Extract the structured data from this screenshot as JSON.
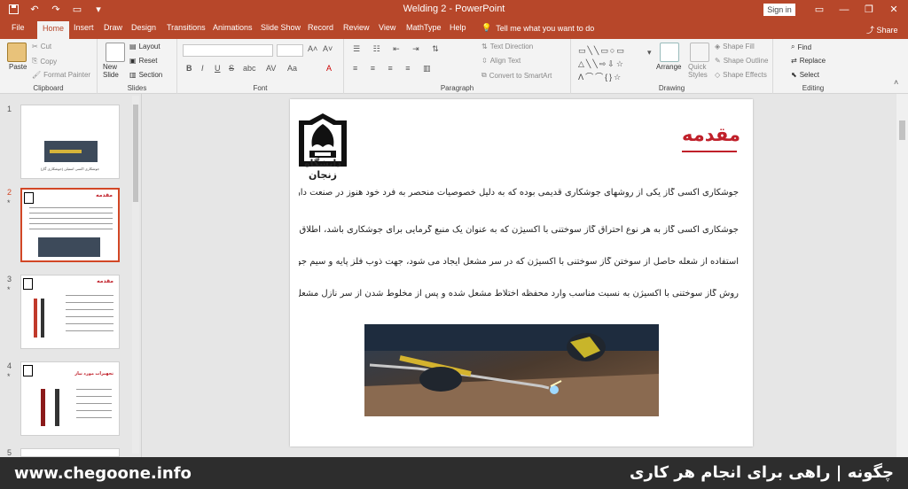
{
  "window": {
    "title": "Welding 2  -  PowerPoint",
    "signin": "Sign in"
  },
  "tabs": [
    "File",
    "Home",
    "Insert",
    "Draw",
    "Design",
    "Transitions",
    "Animations",
    "Slide Show",
    "Record",
    "Review",
    "View",
    "MathType",
    "Help"
  ],
  "tell_me": "Tell me what you want to do",
  "share": "Share",
  "ribbon": {
    "clipboard": {
      "label": "Clipboard",
      "paste": "Paste",
      "cut": "Cut",
      "copy": "Copy",
      "format_painter": "Format Painter"
    },
    "slides": {
      "label": "Slides",
      "new_slide": "New Slide",
      "layout": "Layout",
      "reset": "Reset",
      "section": "Section"
    },
    "font": {
      "label": "Font",
      "bold": "B",
      "italic": "I",
      "underline": "U",
      "strike": "S",
      "shadow": "abc",
      "spacing": "AV",
      "case": "Aa",
      "color": "A"
    },
    "paragraph": {
      "label": "Paragraph",
      "text_direction": "Text Direction",
      "align_text": "Align Text",
      "smartart": "Convert to SmartArt"
    },
    "drawing": {
      "label": "Drawing",
      "arrange": "Arrange",
      "quick_styles": "Quick Styles",
      "shape_fill": "Shape Fill",
      "shape_outline": "Shape Outline",
      "shape_effects": "Shape Effects"
    },
    "editing": {
      "label": "Editing",
      "find": "Find",
      "replace": "Replace",
      "select": "Select"
    }
  },
  "thumbnails": [
    {
      "number": "1",
      "caption": "جوشکاری اکسی استیلن (جوشکاری گاز)"
    },
    {
      "number": "2",
      "star": "*",
      "title": "مقدمه"
    },
    {
      "number": "3",
      "star": "*",
      "title": "مقدمه"
    },
    {
      "number": "4",
      "star": "*",
      "title": "تجهیزات مورد نیاز"
    },
    {
      "number": "5"
    }
  ],
  "slide": {
    "logo_text": "دانشگاه زنجان",
    "heading": "مقدمه",
    "paragraphs": [
      "جوشکاری اکسی گاز یکی از روشهای جوشکاری قدیمی بوده که به دلیل خصوصیات منحصر به فرد خود هنوز در صنعت دارای کاربرد وسیعی می باشد.",
      "جوشکاری اکسی گاز به هر نوع احتراق گاز سوختنی با اکسیژن که به عنوان یک منبع گرمایی برای جوشکاری باشد، اطلاق می گردد. در این روش با",
      "استفاده از شعله حاصل از سوختن گاز سوختنی با اکسیژن که در سر مشعل ایجاد می شود، جهت ذوب فلز پایه و سیم جوش استفاده می گردد. در این",
      "روش گاز سوختنی با اکسیژن به نسبت مناسب وارد محفظه اختلاط مشعل شده و پس از مخلوط شدن از سر نازل مشعل خارج شده و محترق می شود."
    ]
  },
  "footer": {
    "site": "www.chegoone.info",
    "slogan": "چگونه | راهی برای انجام هر کاری"
  },
  "colors": {
    "accent": "#b7472a",
    "heading": "#c0202a",
    "footer": "#2d2d2d"
  }
}
